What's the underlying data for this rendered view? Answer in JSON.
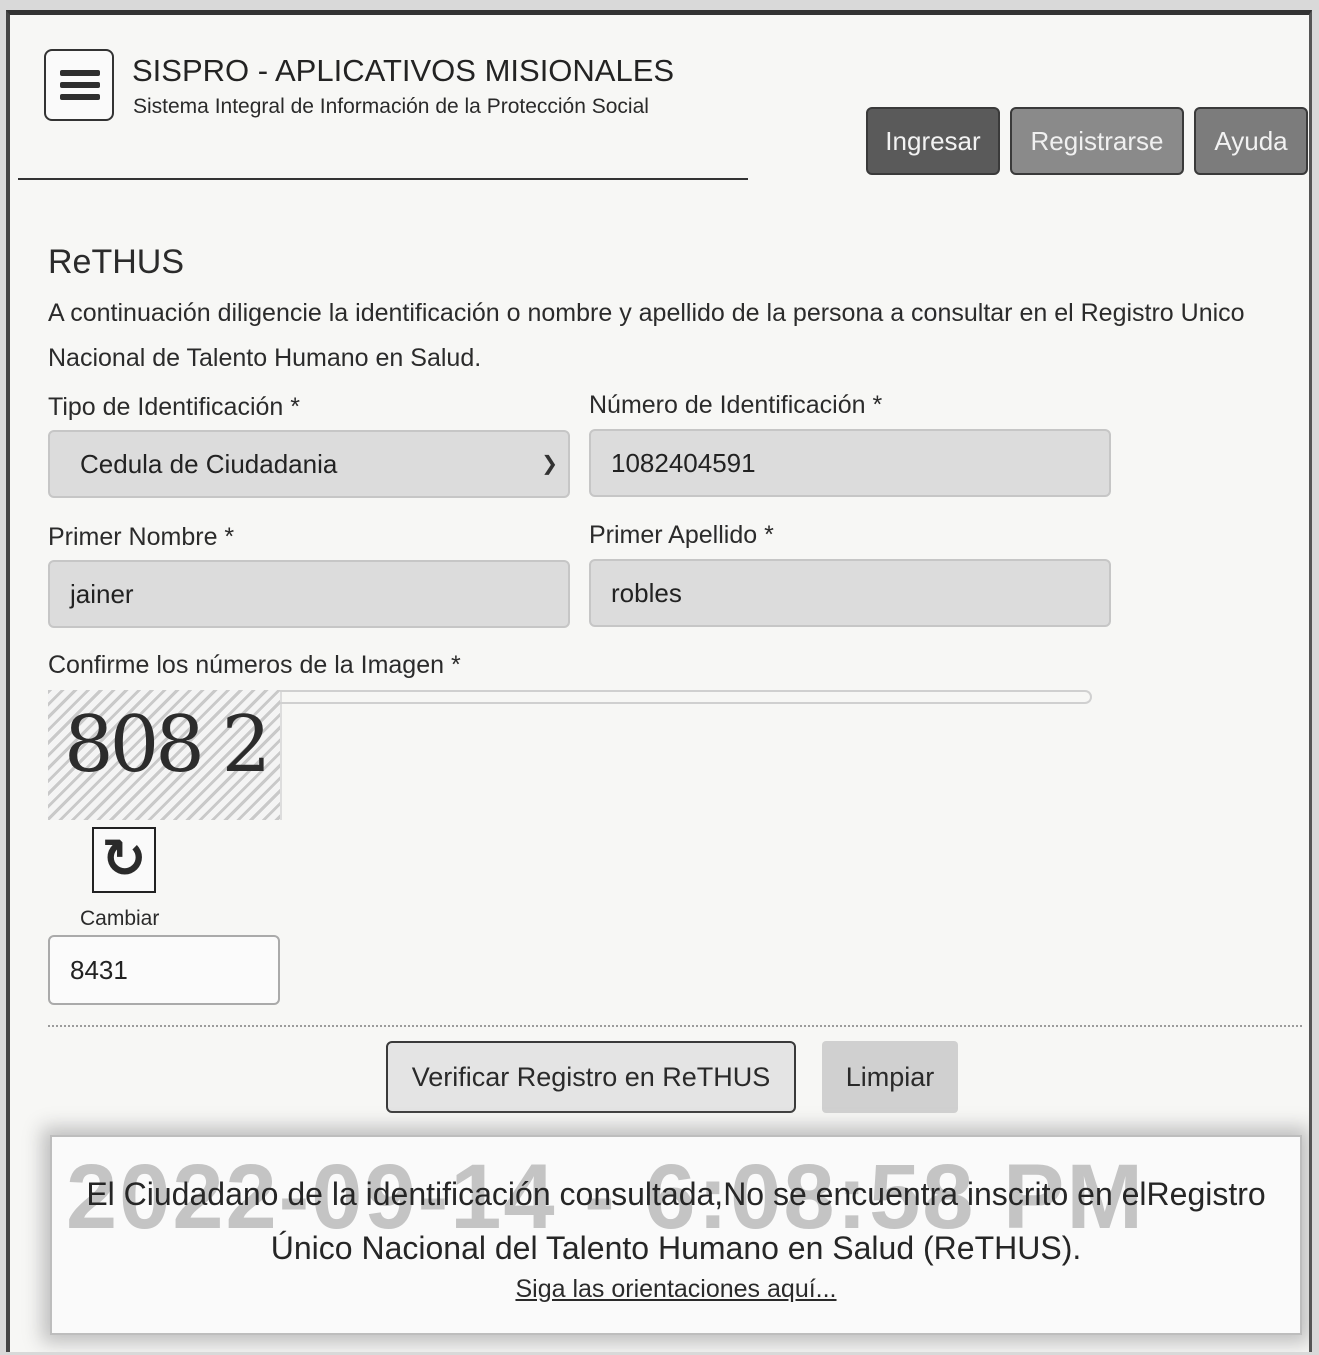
{
  "header": {
    "menu_icon": "hamburger-menu-icon",
    "title": "SISPRO - APLICATIVOS MISIONALES",
    "subtitle": "Sistema Integral de Información de la Protección Social",
    "buttons": {
      "login": "Ingresar",
      "register": "Registrarse",
      "help": "Ayuda"
    }
  },
  "page": {
    "title": "ReTHUS",
    "intro": "A continuación diligencie la identificación o nombre y apellido de la persona a consultar en el Registro Unico Nacional de Talento Humano en Salud."
  },
  "form": {
    "id_type": {
      "label": "Tipo de Identificación *",
      "value": "Cedula de Ciudadania"
    },
    "id_number": {
      "label": "Número de Identificación *",
      "value": "1082404591"
    },
    "first_name": {
      "label": "Primer Nombre *",
      "value": "jainer"
    },
    "first_surname": {
      "label": "Primer Apellido *",
      "value": "robles"
    },
    "captcha": {
      "label": "Confirme los números de la Imagen *",
      "image_text": "808 2",
      "refresh_icon": "refresh-icon",
      "refresh_label": "Cambiar",
      "value": "8431"
    }
  },
  "actions": {
    "verify": "Verificar Registro en ReTHUS",
    "clear": "Limpiar"
  },
  "result": {
    "timestamp_watermark": "2022-09-14 - 6:08:58 PM",
    "message": "El Ciudadano de la identificación consultada,No se encuentra inscrito en elRegistro Único Nacional del Talento Humano en Salud (ReTHUS).",
    "link": "Siga las orientaciones aquí..."
  },
  "colors": {
    "btn_login_bg": "#5a5a5a",
    "btn_register_bg": "#8a8a8a",
    "btn_help_bg": "#7c7c7c",
    "field_bg": "#dcdcdc"
  }
}
